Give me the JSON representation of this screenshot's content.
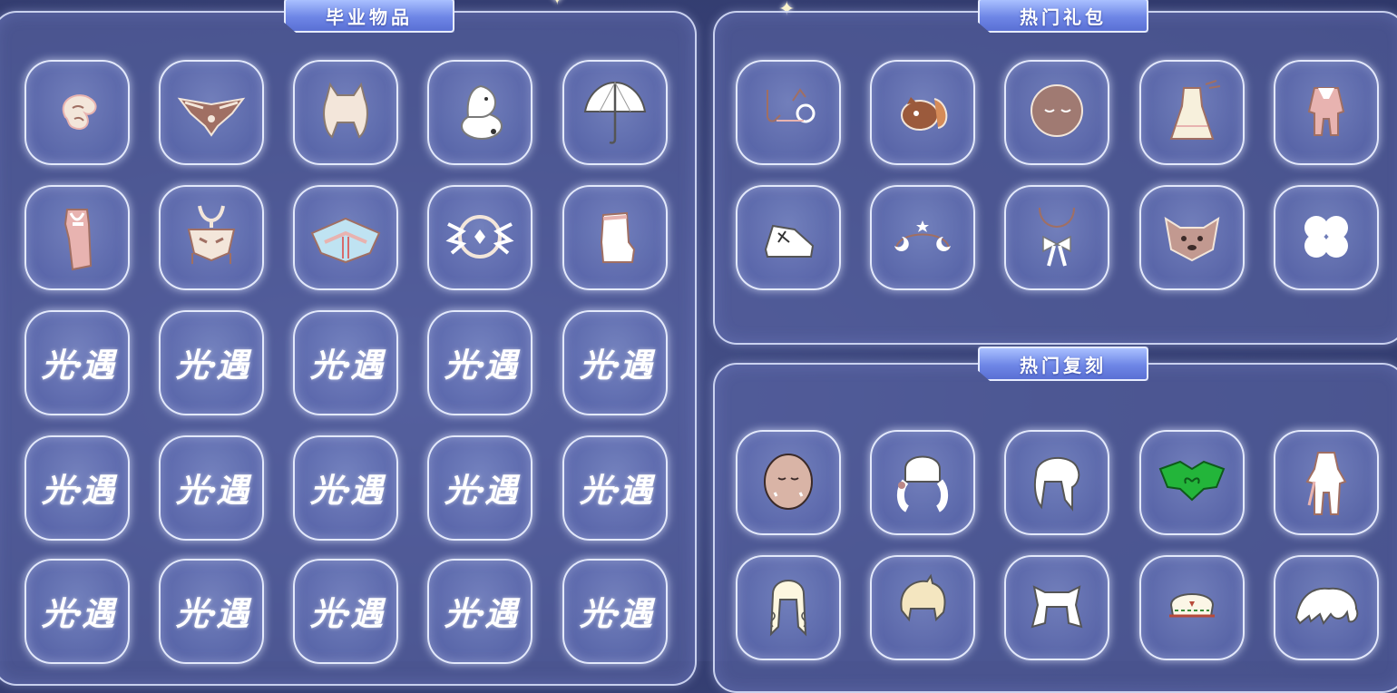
{
  "sections": {
    "graduation": {
      "title": "毕业物品"
    },
    "gifts": {
      "title": "热门礼包"
    },
    "rerun": {
      "title": "热门复刻"
    }
  },
  "placeholder_logo": "光·遇",
  "graduation_items": [
    "white-dragon-hair-icon",
    "brown-wing-cape-icon",
    "cream-bun-hair-icon",
    "moomin-prop-icon",
    "white-umbrella-icon",
    "hooded-scarf-icon",
    "antler-mask-icon",
    "blue-folded-cape-icon",
    "winged-orb-mask-icon",
    "white-boots-icon"
  ],
  "gift_items": [
    "moon-earrings-icon",
    "red-panda-prop-icon",
    "sleepy-mask-icon",
    "white-dress-outfit-icon",
    "pink-outfit-icon",
    "white-shoes-icon",
    "moon-star-headpiece-icon",
    "bow-necklace-icon",
    "dog-mask-icon",
    "four-petal-flower-icon"
  ],
  "rerun_items": [
    "blush-mask-icon",
    "twin-tail-hair-icon",
    "ponytail-hair-icon",
    "green-leaf-cape-icon",
    "white-robe-outfit-icon",
    "curly-long-hair-icon",
    "short-blonde-hair-icon",
    "cat-ear-hair-icon",
    "captain-hat-icon",
    "fluffy-hair-icon"
  ],
  "colors": {
    "background": "#3a4479",
    "banner": "#6e86e6",
    "item_cream": "#f3e6da",
    "item_brown": "#a06f63",
    "item_pink": "#e8b3b0",
    "item_green": "#23b53a"
  }
}
